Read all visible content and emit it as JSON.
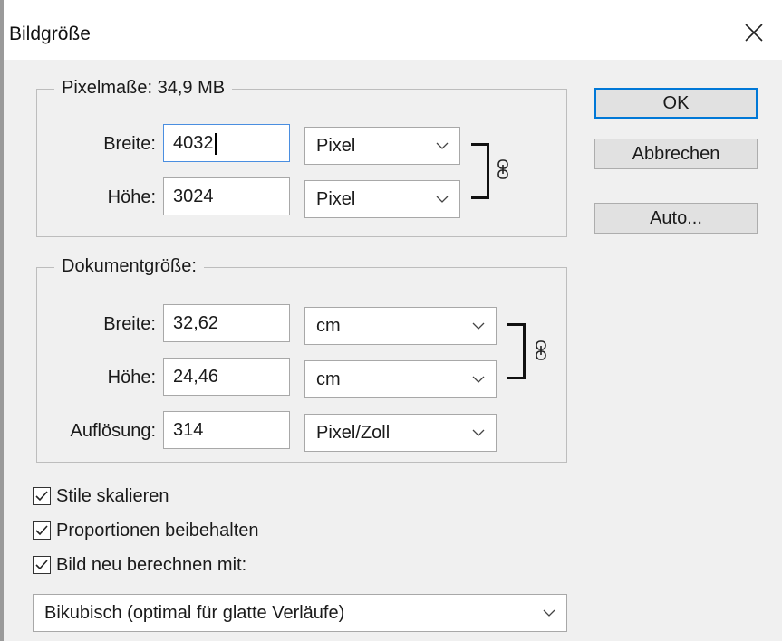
{
  "dialog": {
    "title": "Bildgröße",
    "close_icon": "close-icon"
  },
  "pixel_dimensions": {
    "legend": "Pixelmaße: 34,9 MB",
    "width_label": "Breite:",
    "width_value": "4032",
    "width_unit": "Pixel",
    "height_label": "Höhe:",
    "height_value": "3024",
    "height_unit": "Pixel"
  },
  "document_size": {
    "legend": "Dokumentgröße:",
    "width_label": "Breite:",
    "width_value": "32,62",
    "width_unit": "cm",
    "height_label": "Höhe:",
    "height_value": "24,46",
    "height_unit": "cm",
    "resolution_label": "Auflösung:",
    "resolution_value": "314",
    "resolution_unit": "Pixel/Zoll"
  },
  "buttons": {
    "ok": "OK",
    "cancel": "Abbrechen",
    "auto": "Auto..."
  },
  "options": {
    "scale_styles": {
      "label": "Stile skalieren",
      "checked": true
    },
    "constrain_proportions": {
      "label": "Proportionen beibehalten",
      "checked": true
    },
    "resample": {
      "label": "Bild neu berechnen mit:",
      "checked": true
    }
  },
  "resample_method": {
    "selected": "Bikubisch (optimal für glatte Verläufe)"
  },
  "colors": {
    "accent": "#0078d7",
    "dialog_bg": "#f0f0f0",
    "focus_border": "#4a8ee0"
  }
}
